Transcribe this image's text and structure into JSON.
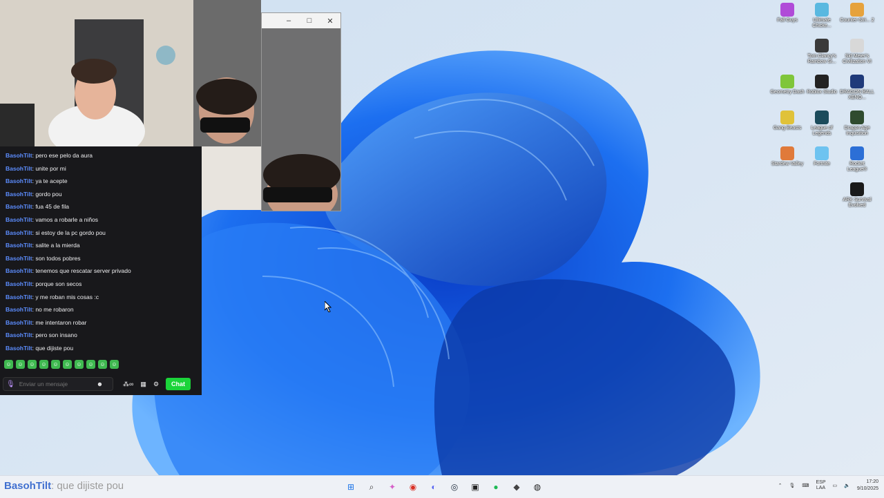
{
  "chat": {
    "username": "BasohTilt",
    "messages": [
      "pero ese pelo da aura",
      "unite por mi",
      "ya te acepte",
      "gordo pou",
      "fua 45 de fila",
      "vamos a robarle a niños",
      "si estoy de la pc gordo pou",
      "salite a la mierda",
      "son todos pobres",
      "tenemos que rescatar server privado",
      "porque son secos",
      "y me roban mis cosas :c",
      "no me robaron",
      "me intentaron robar",
      "pero son insano",
      "que dijiste pou"
    ],
    "input_placeholder": "Enviar un mensaje",
    "chat_button": "Chat",
    "emote_count": 10
  },
  "desktop_icons": [
    {
      "label": "Fall Guys",
      "color": "#b04bd8"
    },
    {
      "label": "Ultimate Chicke...",
      "color": "#59b8e0"
    },
    {
      "label": "Counter-Stri... 2",
      "color": "#e6a23c"
    },
    {
      "label": "Tom Clancy's Rainbow Si...",
      "color": "#3a3a3a"
    },
    {
      "label": "Sid Meier's Civilization VI",
      "color": "#d8d8d8"
    },
    {
      "label": "Geometry Dash",
      "color": "#7fc63a"
    },
    {
      "label": "Roblox Studio",
      "color": "#222222"
    },
    {
      "label": "DRAGON BALL XENO...",
      "color": "#1f3a7a"
    },
    {
      "label": "Gang Beasts",
      "color": "#e0c23a"
    },
    {
      "label": "League of Legends",
      "color": "#1b4b5c"
    },
    {
      "label": "Dragon Age Inquisition",
      "color": "#2f4b2f"
    },
    {
      "label": "Stardew Valley",
      "color": "#e07a3a"
    },
    {
      "label": "Fortnite",
      "color": "#6ec3f0"
    },
    {
      "label": "Rocket League®",
      "color": "#2c6fd6"
    },
    {
      "label": "ARK Survival Evolved",
      "color": "#1a1a1a"
    }
  ],
  "webcam_window": {
    "minimize": "–",
    "maximize": "□",
    "close": "✕"
  },
  "taskbar": {
    "caption_user": "BasohTilt",
    "caption_message": ": que dijiste pou",
    "apps": [
      {
        "name": "start",
        "glyph": "⊞",
        "color": "#1a73e8"
      },
      {
        "name": "search",
        "glyph": "⌕",
        "color": "#333333"
      },
      {
        "name": "copilot",
        "glyph": "✦",
        "color": "#d65fc8"
      },
      {
        "name": "chrome",
        "glyph": "◉",
        "color": "#d93025"
      },
      {
        "name": "discord",
        "glyph": "◐",
        "color": "#5865f2"
      },
      {
        "name": "steam",
        "glyph": "◎",
        "color": "#1b2838"
      },
      {
        "name": "epic",
        "glyph": "▣",
        "color": "#222222"
      },
      {
        "name": "spotify",
        "glyph": "●",
        "color": "#1db954"
      },
      {
        "name": "app-red",
        "glyph": "◆",
        "color": "#444444"
      },
      {
        "name": "obs",
        "glyph": "◍",
        "color": "#222222"
      }
    ],
    "lang_top": "ESP",
    "lang_bottom": "LAA",
    "time": "17:20",
    "date": "9/10/2025"
  }
}
